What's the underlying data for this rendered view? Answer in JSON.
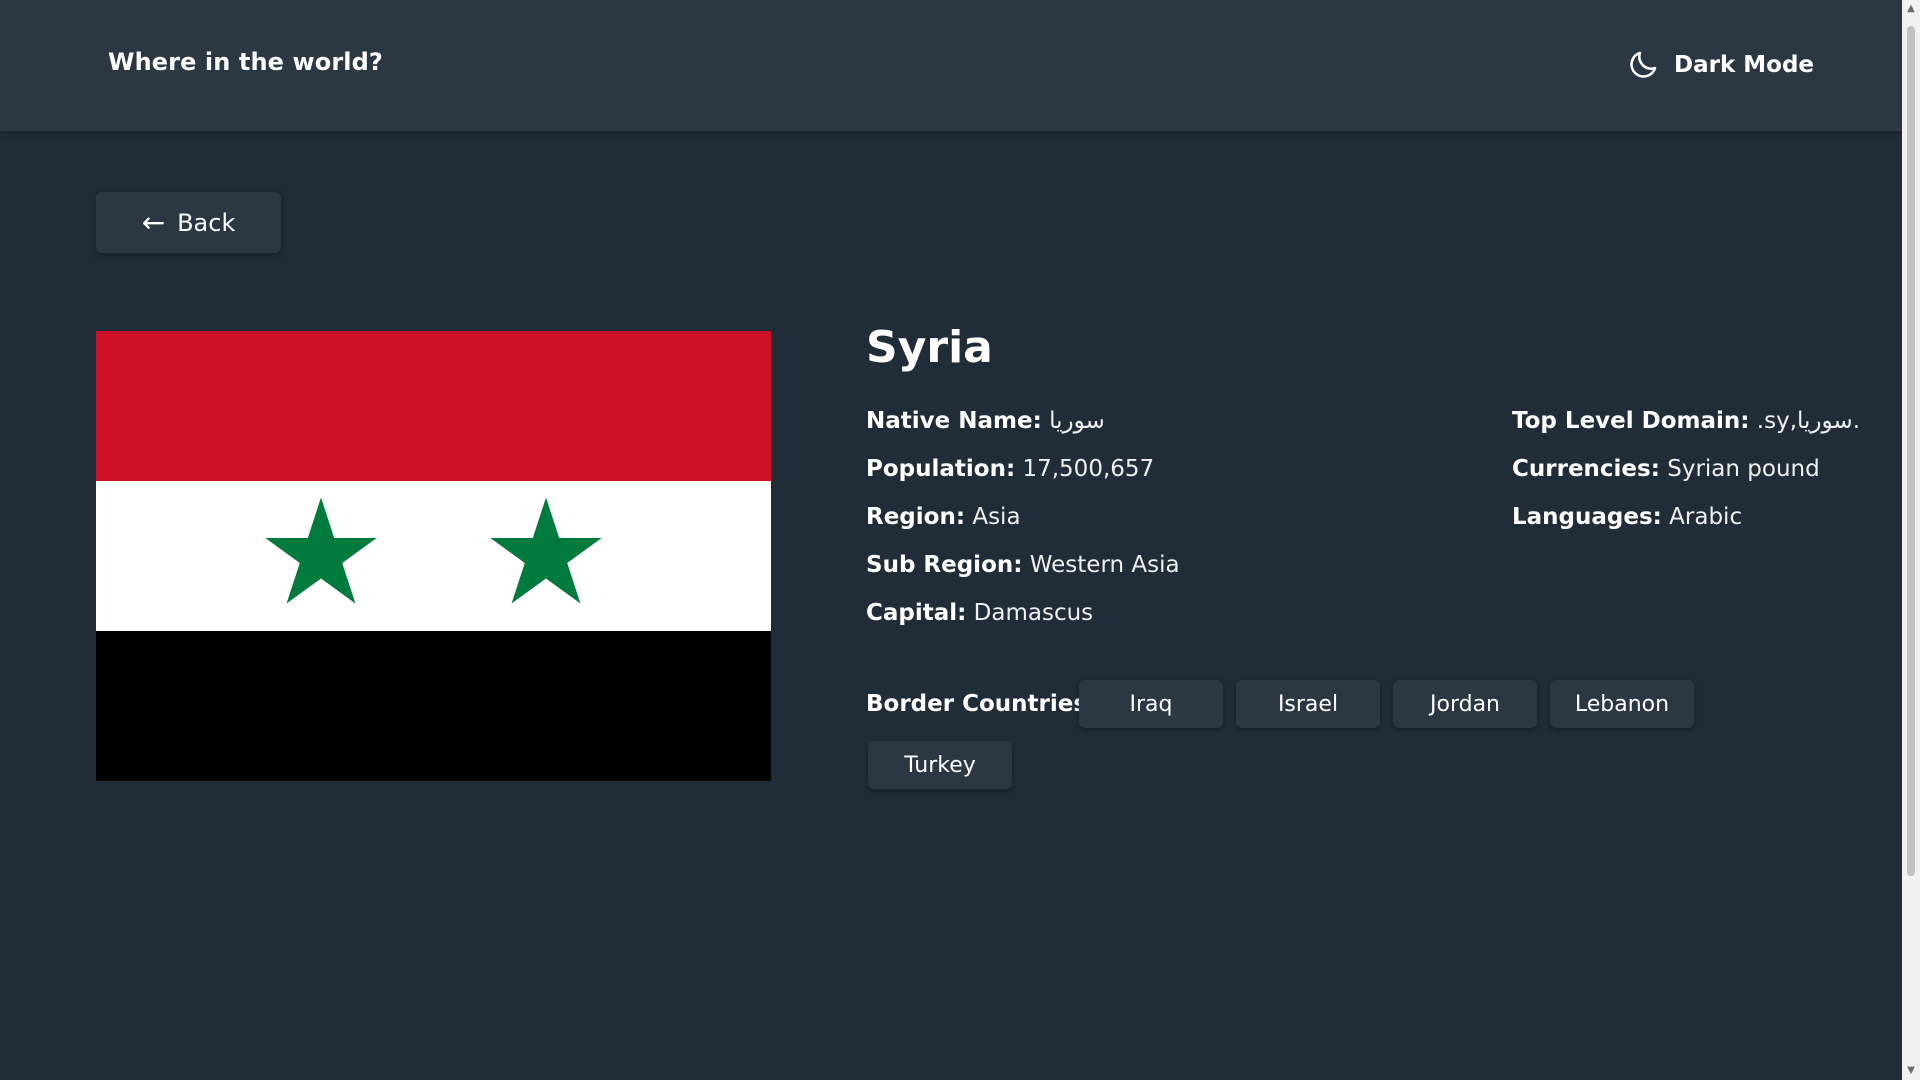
{
  "header": {
    "title": "Where in the world?",
    "mode_label": "Dark Mode",
    "mode_icon": "moon-icon"
  },
  "back_button": {
    "icon": "arrow-left-icon",
    "arrow_glyph": "←",
    "label": "Back"
  },
  "country": {
    "name": "Syria",
    "flag_colors": {
      "red": "#ce1126",
      "white": "#ffffff",
      "black": "#000000",
      "star": "#007a3d"
    },
    "left_details": [
      {
        "label": "Native Name:",
        "value": "سوريا"
      },
      {
        "label": "Population:",
        "value": "17,500,657"
      },
      {
        "label": "Region:",
        "value": "Asia"
      },
      {
        "label": "Sub Region:",
        "value": "Western Asia"
      },
      {
        "label": "Capital:",
        "value": "Damascus"
      }
    ],
    "right_details": [
      {
        "label": "Top Level Domain:",
        "value": ".sy,سوريا."
      },
      {
        "label": "Currencies:",
        "value": "Syrian pound"
      },
      {
        "label": "Languages:",
        "value": "Arabic"
      }
    ],
    "border_label": "Border Countries :",
    "borders": [
      "Iraq",
      "Israel",
      "Jordan",
      "Lebanon",
      "Turkey"
    ]
  },
  "colors": {
    "background": "#202c37",
    "surface": "#2b3743",
    "text": "#ffffff"
  }
}
